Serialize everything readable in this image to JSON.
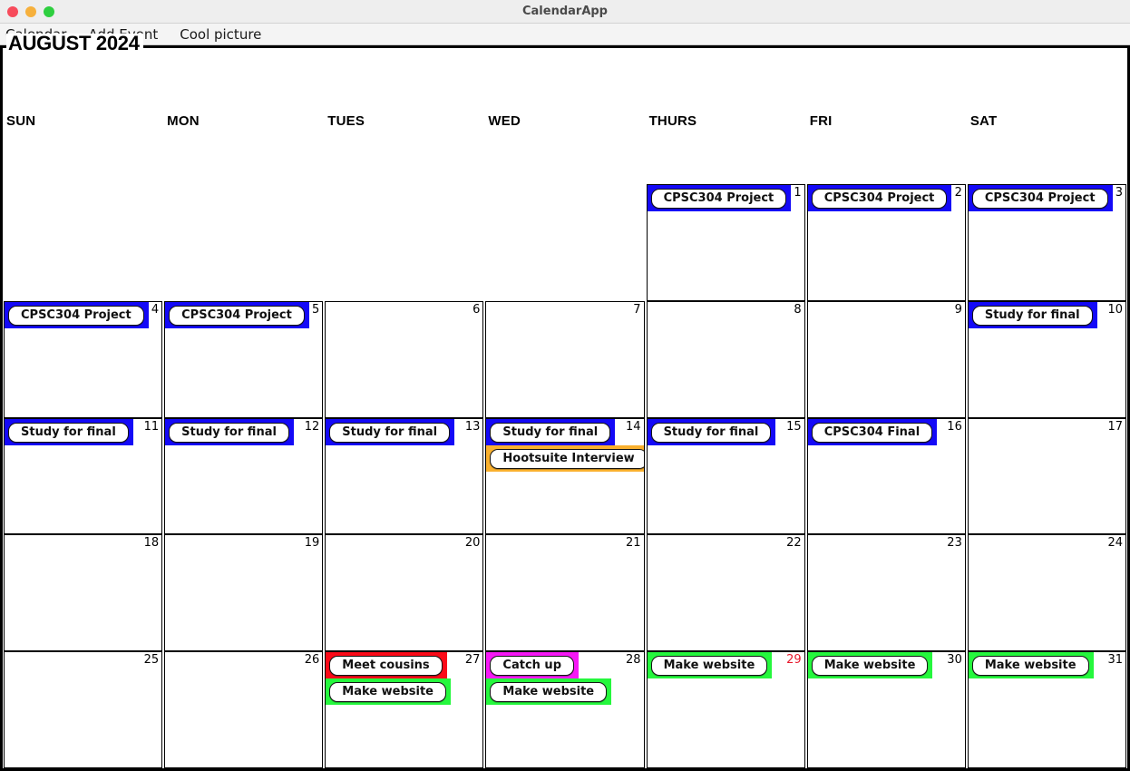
{
  "window": {
    "title": "CalendarApp",
    "traffic_lights": [
      {
        "name": "close-button",
        "color": "#f74b5b"
      },
      {
        "name": "minimize-button",
        "color": "#f6b03c"
      },
      {
        "name": "maximize-button",
        "color": "#2ecf3f"
      }
    ]
  },
  "menubar": {
    "items": [
      {
        "label": "Calendar"
      },
      {
        "label": "Add Event"
      },
      {
        "label": "Cool picture"
      }
    ]
  },
  "calendar": {
    "month_title": "AUGUST 2024",
    "weekdays": [
      "SUN",
      "MON",
      "TUES",
      "WED",
      "THURS",
      "FRI",
      "SAT"
    ],
    "event_colors": {
      "blue": "#1409f7",
      "orange": "#f9b02e",
      "green": "#25f73d",
      "red": "#fb0a18",
      "magenta": "#f618f6"
    },
    "today": 29,
    "weeks": [
      [
        {
          "day": null,
          "events": []
        },
        {
          "day": null,
          "events": []
        },
        {
          "day": null,
          "events": []
        },
        {
          "day": null,
          "events": []
        },
        {
          "day": "1",
          "events": [
            {
              "label": "CPSC304 Project",
              "color": "#1409f7"
            }
          ]
        },
        {
          "day": "2",
          "events": [
            {
              "label": "CPSC304 Project",
              "color": "#1409f7"
            }
          ]
        },
        {
          "day": "3",
          "events": [
            {
              "label": "CPSC304 Project",
              "color": "#1409f7"
            }
          ]
        }
      ],
      [
        {
          "day": "4",
          "events": [
            {
              "label": "CPSC304 Project",
              "color": "#1409f7"
            }
          ]
        },
        {
          "day": "5",
          "events": [
            {
              "label": "CPSC304 Project",
              "color": "#1409f7"
            }
          ]
        },
        {
          "day": "6",
          "events": []
        },
        {
          "day": "7",
          "events": []
        },
        {
          "day": "8",
          "events": []
        },
        {
          "day": "9",
          "events": []
        },
        {
          "day": "10",
          "events": [
            {
              "label": "Study for final",
              "color": "#1409f7"
            }
          ]
        }
      ],
      [
        {
          "day": "11",
          "events": [
            {
              "label": "Study for final",
              "color": "#1409f7"
            }
          ]
        },
        {
          "day": "12",
          "events": [
            {
              "label": "Study for final",
              "color": "#1409f7"
            }
          ]
        },
        {
          "day": "13",
          "events": [
            {
              "label": "Study for final",
              "color": "#1409f7"
            }
          ]
        },
        {
          "day": "14",
          "events": [
            {
              "label": "Study for final",
              "color": "#1409f7"
            },
            {
              "label": "Hootsuite Interview",
              "color": "#f9b02e"
            }
          ]
        },
        {
          "day": "15",
          "events": [
            {
              "label": "Study for final",
              "color": "#1409f7"
            }
          ]
        },
        {
          "day": "16",
          "events": [
            {
              "label": "CPSC304 Final",
              "color": "#1409f7"
            }
          ]
        },
        {
          "day": "17",
          "events": []
        }
      ],
      [
        {
          "day": "18",
          "events": []
        },
        {
          "day": "19",
          "events": []
        },
        {
          "day": "20",
          "events": []
        },
        {
          "day": "21",
          "events": []
        },
        {
          "day": "22",
          "events": []
        },
        {
          "day": "23",
          "events": []
        },
        {
          "day": "24",
          "events": []
        }
      ],
      [
        {
          "day": "25",
          "events": []
        },
        {
          "day": "26",
          "events": []
        },
        {
          "day": "27",
          "events": [
            {
              "label": "Meet cousins",
              "color": "#fb0a18"
            },
            {
              "label": "Make website",
              "color": "#25f73d"
            }
          ]
        },
        {
          "day": "28",
          "events": [
            {
              "label": "Catch up",
              "color": "#f618f6"
            },
            {
              "label": "Make website",
              "color": "#25f73d"
            }
          ]
        },
        {
          "day": "29",
          "today": true,
          "events": [
            {
              "label": "Make website",
              "color": "#25f73d"
            }
          ]
        },
        {
          "day": "30",
          "events": [
            {
              "label": "Make website",
              "color": "#25f73d"
            }
          ]
        },
        {
          "day": "31",
          "events": [
            {
              "label": "Make website",
              "color": "#25f73d"
            }
          ]
        }
      ]
    ]
  }
}
